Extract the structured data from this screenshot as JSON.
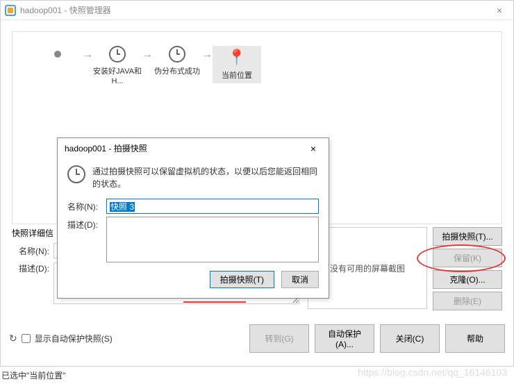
{
  "window": {
    "title": "hadoop001 - 快照管理器",
    "close": "×"
  },
  "timeline": {
    "nodes": [
      {
        "label": "安装好JAVA和H..."
      },
      {
        "label": "伪分布式成功"
      },
      {
        "label": "当前位置"
      }
    ]
  },
  "details": {
    "header": "快照详细信",
    "name_label": "名称(N):",
    "desc_label": "描述(D):",
    "preview_text": "没有可用的屏幕截图"
  },
  "side_buttons": {
    "take": "拍摄快照(T)...",
    "keep": "保留(K)",
    "clone": "克隆(O)...",
    "delete": "删除(E)"
  },
  "bottom": {
    "restore_icon": "↻",
    "checkbox_label": "显示自动保护快照(S)",
    "goto": "转到(G)",
    "autoprotect": "自动保护(A)...",
    "close": "关闭(C)",
    "help": "帮助"
  },
  "dialog": {
    "title": "hadoop001 - 拍摄快照",
    "close": "×",
    "description": "通过拍摄快照可以保留虚拟机的状态，以便以后您能返回相同的状态。",
    "name_label": "名称(N):",
    "name_value": "快照 3",
    "desc_label": "描述(D):",
    "desc_value": "",
    "ok": "拍摄快照(T)",
    "cancel": "取消"
  },
  "status": {
    "text": "已选中\"当前位置\""
  },
  "watermark": "https://blog.csdn.net/qq_16146103"
}
